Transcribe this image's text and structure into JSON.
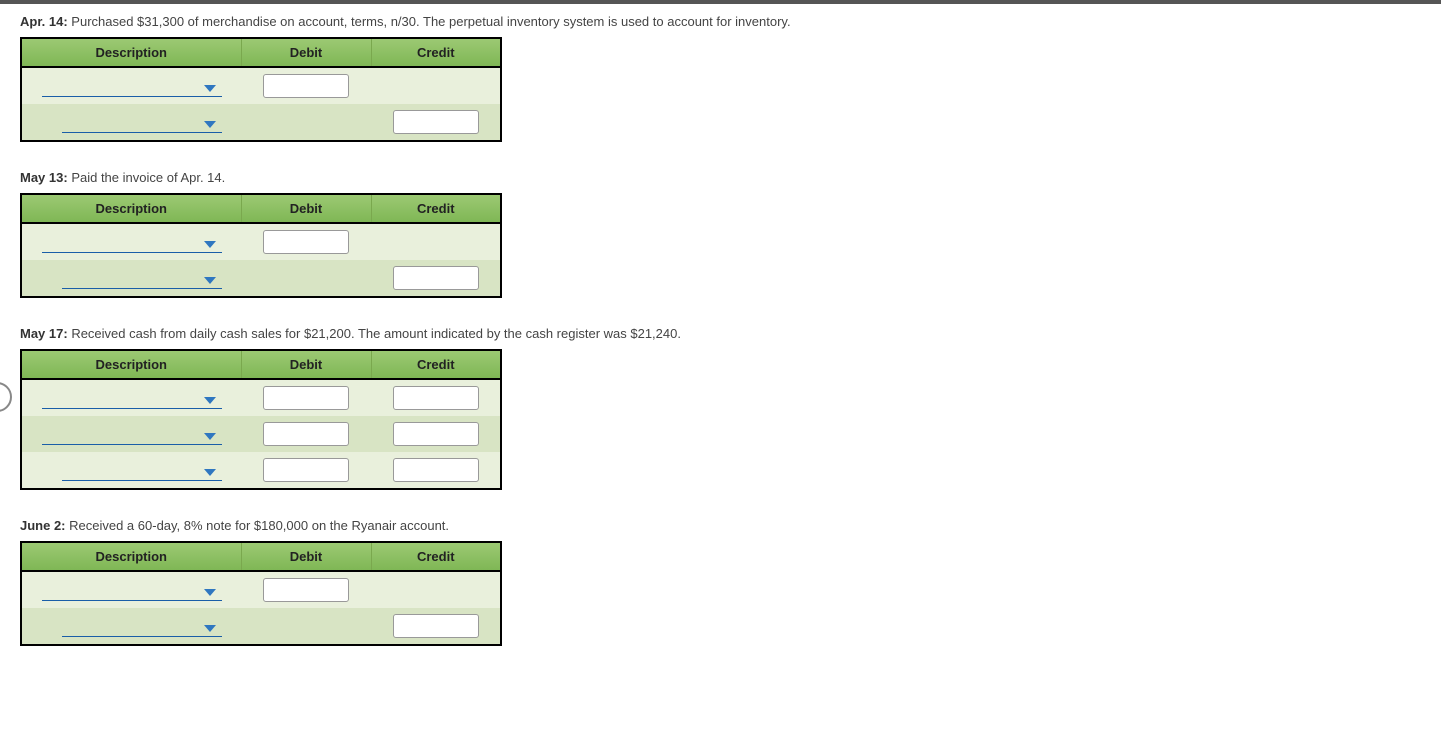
{
  "headers": {
    "description": "Description",
    "debit": "Debit",
    "credit": "Credit"
  },
  "entries": [
    {
      "date_label": "Apr. 14:",
      "text": " Purchased $31,300 of merchandise on account, terms, n/30. The perpetual inventory system is used to account for inventory.",
      "rows": [
        {
          "desc": "",
          "debit": "",
          "credit": null,
          "indent": false
        },
        {
          "desc": "",
          "debit": null,
          "credit": "",
          "indent": true
        }
      ]
    },
    {
      "date_label": "May 13:",
      "text": " Paid the invoice of Apr. 14.",
      "rows": [
        {
          "desc": "",
          "debit": "",
          "credit": null,
          "indent": false
        },
        {
          "desc": "",
          "debit": null,
          "credit": "",
          "indent": true
        }
      ]
    },
    {
      "date_label": "May 17:",
      "text": " Received cash from daily cash sales for $21,200. The amount indicated by the cash register was $21,240.",
      "rows": [
        {
          "desc": "",
          "debit": "",
          "credit": "",
          "indent": false
        },
        {
          "desc": "",
          "debit": "",
          "credit": "",
          "indent": false
        },
        {
          "desc": "",
          "debit": "",
          "credit": "",
          "indent": true
        }
      ]
    },
    {
      "date_label": "June 2:",
      "text": " Received a 60-day, 8% note for $180,000 on the Ryanair account.",
      "rows": [
        {
          "desc": "",
          "debit": "",
          "credit": null,
          "indent": false
        },
        {
          "desc": "",
          "debit": null,
          "credit": "",
          "indent": true
        }
      ]
    }
  ]
}
